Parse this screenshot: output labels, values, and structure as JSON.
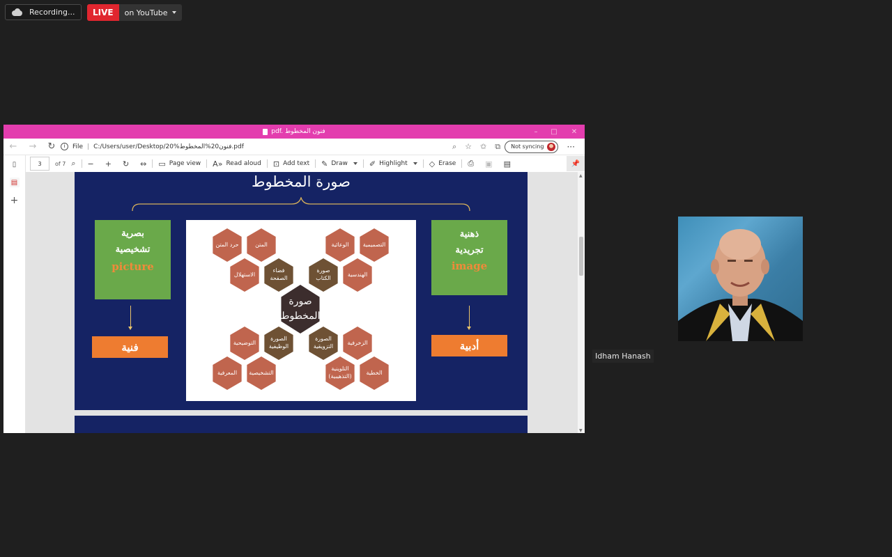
{
  "recording": {
    "label": "Recording..."
  },
  "live": {
    "badge": "LIVE",
    "destination": "on YouTube"
  },
  "window": {
    "title": "pdf. فنون المخطوط"
  },
  "address": {
    "file_label": "File",
    "separator": "|",
    "url": "C:/Users/user/Desktop/فنون20%المخطوط%20.pdf",
    "sync_label": "Not syncing"
  },
  "toolbar": {
    "page_value": "3",
    "page_total": "of 7",
    "page_view": "Page view",
    "read_aloud": "Read aloud",
    "add_text": "Add text",
    "draw": "Draw",
    "highlight": "Highlight",
    "erase": "Erase"
  },
  "slide": {
    "title": "صورة المخطوط",
    "left_box": {
      "line1": "بصرية",
      "line2": "تشخيصية",
      "english": "picture"
    },
    "right_box": {
      "line1": "ذهنية",
      "line2": "تجريدية",
      "english": "image"
    },
    "left_result": "فنية",
    "right_result": "أدبية",
    "center": {
      "line1": "صورة",
      "line2": "المخطوط"
    },
    "hexes": {
      "h1": "حرد المتن",
      "h2": "المتن",
      "h3": "الاستهلال",
      "h4a": "فضاء",
      "h4b": "الصفحة",
      "h5": "الوعائية",
      "h6": "التصميمية",
      "h7a": "صورة",
      "h7b": "الكتاب",
      "h8": "الهندسية",
      "h9": "التوضيحية",
      "h10a": "الصورة",
      "h10b": "الوظيفية",
      "h11": "المعرفية",
      "h12": "التشخيصية",
      "h13a": "الصورة",
      "h13b": "التزويقية",
      "h14": "الزخرفية",
      "h15a": "التلوينية",
      "h15b": "(التذهيبية)",
      "h16": "الخطية"
    }
  },
  "participant": {
    "name": "Idham Hanash"
  },
  "colors": {
    "titlebar": "#e33dae",
    "slide_bg": "#152364",
    "green_box": "#6aa94a",
    "orange_box": "#ee7c30",
    "hex_light": "#c0654e",
    "hex_dark": "#6e5134",
    "live_red": "#e0262f"
  }
}
